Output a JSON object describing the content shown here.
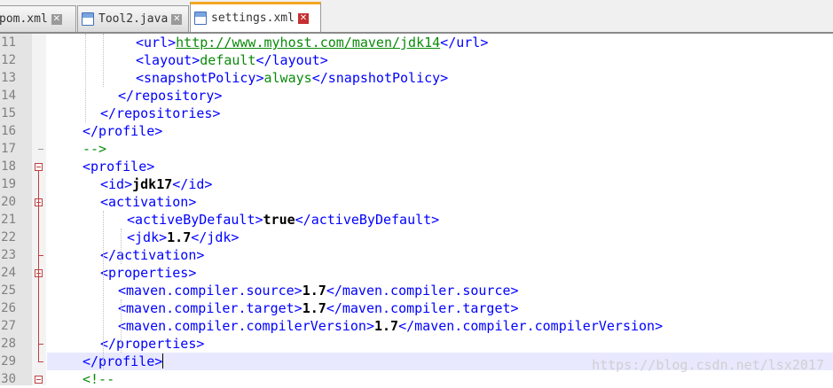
{
  "tabs": [
    {
      "label": "pom.xml"
    },
    {
      "label": "Tool2.java"
    },
    {
      "label": "settings.xml"
    }
  ],
  "lines": [
    {
      "num": "11",
      "code": "<url>http://www.myhost.com/maven/jdk14</url>"
    },
    {
      "num": "12",
      "code": "<layout>default</layout>"
    },
    {
      "num": "13",
      "code": "<snapshotPolicy>always</snapshotPolicy>"
    },
    {
      "num": "14",
      "code": "</repository>"
    },
    {
      "num": "15",
      "code": "</repositories>"
    },
    {
      "num": "16",
      "code": "</profile>"
    },
    {
      "num": "17",
      "code": "-->"
    },
    {
      "num": "18",
      "code": "<profile>"
    },
    {
      "num": "19",
      "code": "<id>jdk17</id>"
    },
    {
      "num": "20",
      "code": "<activation>"
    },
    {
      "num": "21",
      "code": "<activeByDefault>true</activeByDefault>"
    },
    {
      "num": "22",
      "code": "<jdk>1.7</jdk>"
    },
    {
      "num": "23",
      "code": "</activation>"
    },
    {
      "num": "24",
      "code": "<properties>"
    },
    {
      "num": "25",
      "code": "<maven.compiler.source>1.7</maven.compiler.source>"
    },
    {
      "num": "26",
      "code": "<maven.compiler.target>1.7</maven.compiler.target>"
    },
    {
      "num": "27",
      "code": "<maven.compiler.compilerVersion>1.7</maven.compiler.compilerVersion>"
    },
    {
      "num": "28",
      "code": "</properties>"
    },
    {
      "num": "29",
      "code": "</profile>"
    },
    {
      "num": "30",
      "code": "<!--"
    }
  ],
  "watermark": "https://blog.csdn.net/lsx2017",
  "colors": {
    "tag": "#0000ff",
    "comment": "#0a8a0a",
    "active_tab_accent": "#f5a623",
    "current_line": "#e8e8ff"
  },
  "icons": {
    "file": "file-icon",
    "close": "close-icon",
    "fold": "fold-toggle-icon"
  }
}
